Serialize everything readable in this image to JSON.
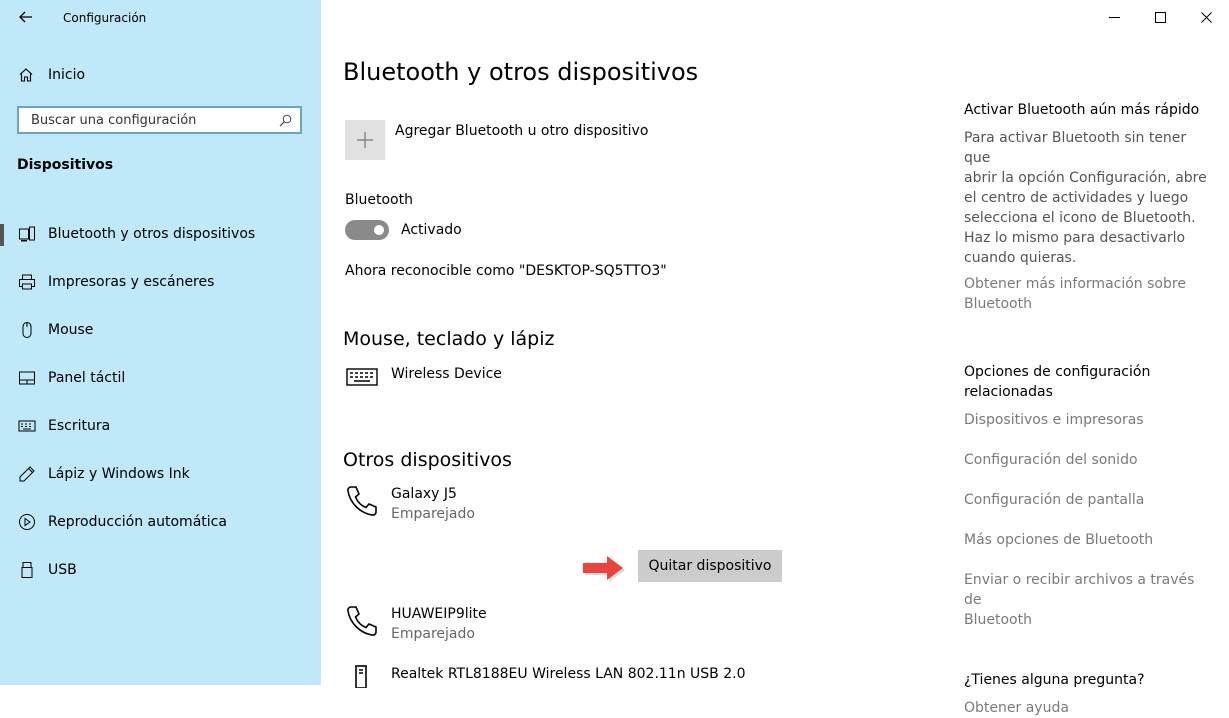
{
  "window": {
    "title": "Configuración",
    "controls": [
      "minimize",
      "maximize",
      "close"
    ]
  },
  "sidebar": {
    "home_label": "Inicio",
    "search_placeholder": "Buscar una configuración",
    "section_title": "Dispositivos",
    "items": [
      {
        "label": "Bluetooth y otros dispositivos",
        "icon": "bluetooth-device-icon",
        "active": true
      },
      {
        "label": "Impresoras y escáneres",
        "icon": "printer-icon",
        "active": false
      },
      {
        "label": "Mouse",
        "icon": "mouse-icon",
        "active": false
      },
      {
        "label": "Panel táctil",
        "icon": "touchpad-icon",
        "active": false
      },
      {
        "label": "Escritura",
        "icon": "keyboard-icon",
        "active": false
      },
      {
        "label": "Lápiz y Windows Ink",
        "icon": "pen-icon",
        "active": false
      },
      {
        "label": "Reproducción automática",
        "icon": "autoplay-icon",
        "active": false
      },
      {
        "label": "USB",
        "icon": "usb-icon",
        "active": false
      }
    ]
  },
  "main": {
    "title": "Bluetooth y otros dispositivos",
    "add_device_label": "Agregar Bluetooth u otro dispositivo",
    "bluetooth_label": "Bluetooth",
    "bluetooth_state": "Activado",
    "discoverable_text": "Ahora reconocible como \"DESKTOP-SQ5TTO3\"",
    "mouse_section_title": "Mouse, teclado y lápiz",
    "mouse_devices": [
      {
        "name": "Wireless Device",
        "icon": "keyboard-icon"
      }
    ],
    "other_section_title": "Otros dispositivos",
    "other_devices": [
      {
        "name": "Galaxy J5",
        "status": "Emparejado",
        "icon": "phone-icon"
      },
      {
        "name": "HUAWEIP9lite",
        "status": "Emparejado",
        "icon": "phone-icon"
      },
      {
        "name": "Realtek RTL8188EU Wireless LAN 802.11n USB 2.0",
        "icon": "network-adapter-icon"
      }
    ],
    "remove_button_label": "Quitar dispositivo",
    "accent_arrow_color": "#e8453c"
  },
  "right_panel": {
    "tip_title": "Activar Bluetooth aún más rápido",
    "tip_lines": [
      "Para activar Bluetooth sin tener que",
      "abrir la opción Configuración, abre",
      "el centro de actividades y luego",
      "selecciona el icono de Bluetooth.",
      "Haz lo mismo para desactivarlo",
      "cuando quieras."
    ],
    "more_info_lines": [
      "Obtener más información sobre",
      "Bluetooth"
    ],
    "related_title_lines": [
      "Opciones de configuración",
      "relacionadas"
    ],
    "related_links": [
      {
        "lines": [
          "Dispositivos e impresoras"
        ]
      },
      {
        "lines": [
          "Configuración del sonido"
        ]
      },
      {
        "lines": [
          "Configuración de pantalla"
        ]
      },
      {
        "lines": [
          "Más opciones de Bluetooth"
        ]
      },
      {
        "lines": [
          "Enviar o recibir archivos a través de",
          "Bluetooth"
        ]
      }
    ],
    "question_title": "¿Tienes alguna pregunta?",
    "help_link": "Obtener ayuda"
  }
}
